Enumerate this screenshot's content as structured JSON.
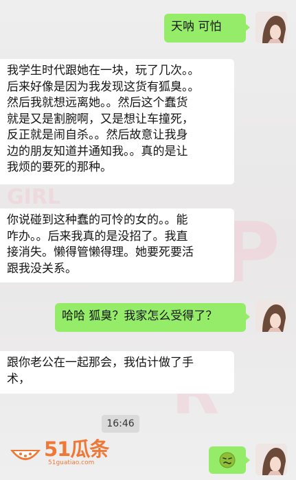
{
  "messages": [
    {
      "side": "out",
      "lines": [
        "天呐 可怕"
      ]
    },
    {
      "side": "in",
      "lines": [
        "我学生时代跟她在一块，玩了几次。。",
        "后来好像是因为我发现这货有狐臭。。",
        "然后我就想远离她。。然后这个蠢货",
        "就是又是割腕啊，又是想让车撞死，",
        "反正就是闹自杀。。然后故意让我身",
        "边的朋友知道并通知我。。真的是让",
        "我烦的要死的那种。"
      ]
    },
    {
      "side": "in",
      "lines": [
        "你说碰到这种蠢的可怜的女的。。能",
        "咋办。。后来我真的是没招了。我直",
        "接消失。懒得管懒得理。她要死要活",
        "跟我没关系。"
      ]
    },
    {
      "side": "out",
      "lines": [
        "哈哈 狐臭？我家怎么受得了？"
      ]
    },
    {
      "side": "in",
      "lines": [
        "跟你老公在一起那会，我估计做了手",
        "术，"
      ]
    },
    {
      "side": "out",
      "lines": [],
      "emoji": "sick-face-emoji"
    }
  ],
  "timestamp": "16:46",
  "watermark": {
    "text": "51瓜条",
    "url": "51guatiao.com"
  },
  "colors": {
    "outgoing_bubble": "#95ec69",
    "incoming_bubble": "#ffffff",
    "background": "#ececec",
    "watermark": "#f07836"
  }
}
